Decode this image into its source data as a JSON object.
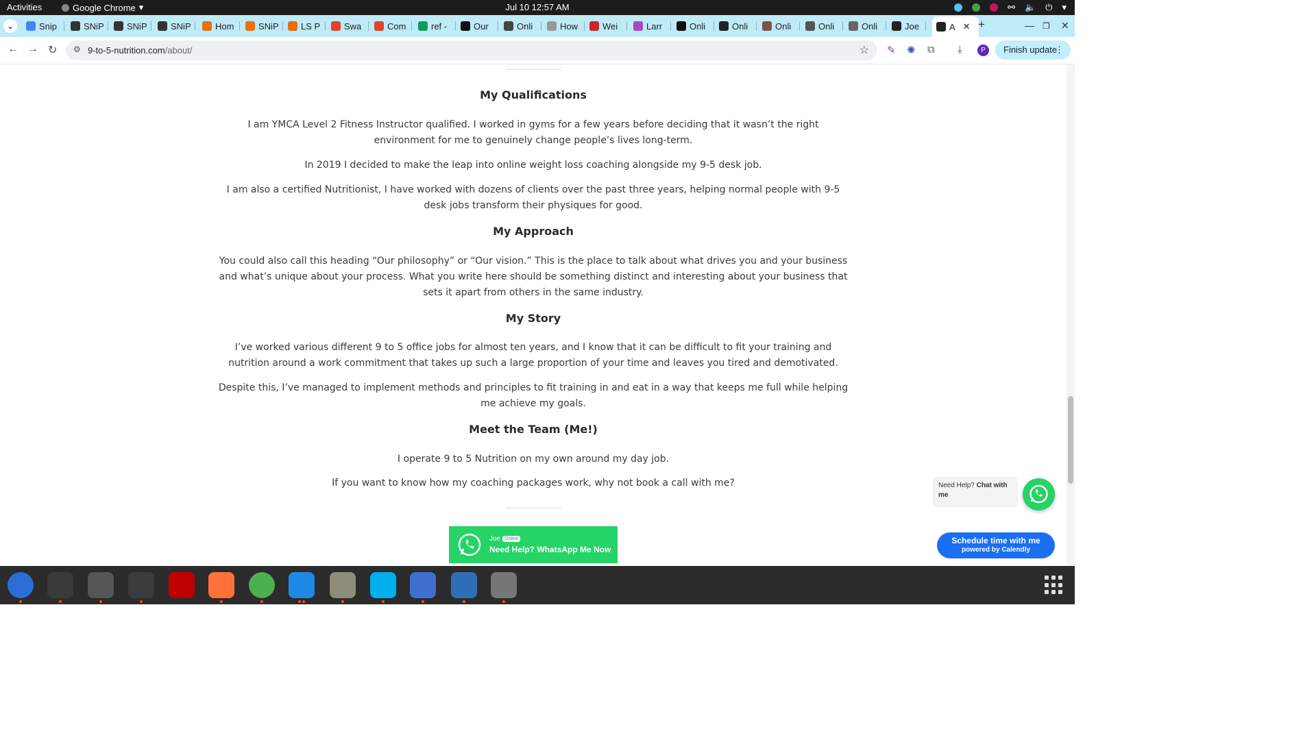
{
  "topbar": {
    "activities": "Activities",
    "app_name": "Google Chrome",
    "clock": "Jul 10  12:57 AM"
  },
  "tabs": [
    {
      "label": "Snip",
      "icon": "doc-icon",
      "color": "#4285f4"
    },
    {
      "label": "SNiP",
      "icon": "snip-logo-icon",
      "color": "#333333"
    },
    {
      "label": "SNiP",
      "icon": "snip-logo-icon",
      "color": "#333333"
    },
    {
      "label": "SNiP",
      "icon": "snip-logo-icon",
      "color": "#333333"
    },
    {
      "label": "Hom",
      "icon": "ls-logo-icon",
      "color": "#e8710a"
    },
    {
      "label": "SNiP",
      "icon": "ls-logo-icon",
      "color": "#e8710a"
    },
    {
      "label": "LS P",
      "icon": "ls-logo-icon",
      "color": "#e8710a"
    },
    {
      "label": "Swa",
      "icon": "gitlab-icon",
      "color": "#e24329"
    },
    {
      "label": "Com",
      "icon": "gitlab-icon",
      "color": "#e24329"
    },
    {
      "label": "ref -",
      "icon": "sheets-icon",
      "color": "#0f9d58"
    },
    {
      "label": "Our",
      "icon": "github-icon",
      "color": "#111111"
    },
    {
      "label": "Onli",
      "icon": "arrow-icon",
      "color": "#444444"
    },
    {
      "label": "How",
      "icon": "globe-icon",
      "color": "#999999"
    },
    {
      "label": "Wei",
      "icon": "chart-icon",
      "color": "#c62828"
    },
    {
      "label": "Larr",
      "icon": "c-logo-icon",
      "color": "#ab47bc"
    },
    {
      "label": "Onli",
      "icon": "square-icon",
      "color": "#111111"
    },
    {
      "label": "Onli",
      "icon": "square-icon",
      "color": "#222222"
    },
    {
      "label": "Onli",
      "icon": "photo-icon",
      "color": "#795548"
    },
    {
      "label": "Onli",
      "icon": "glasses-icon",
      "color": "#555555"
    },
    {
      "label": "Onli",
      "icon": "globe-icon",
      "color": "#666666"
    },
    {
      "label": "Joe",
      "icon": "headset-icon",
      "color": "#222222"
    },
    {
      "label": "A",
      "icon": "headset-icon",
      "color": "#222222"
    }
  ],
  "toolbar": {
    "url_host": "9-to-5-nutrition.com",
    "url_path": "/about/",
    "profile_initial": "P",
    "finish_update": "Finish update"
  },
  "content": {
    "qualifications": {
      "heading": "My Qualifications",
      "p1": "I am YMCA Level 2 Fitness Instructor qualified. I worked in gyms for a few years before deciding that it wasn’t the right environment for me to genuinely change people’s lives long-term.",
      "p2": "In 2019 I decided to make the leap into online weight loss coaching alongside my 9-5 desk job.",
      "p3": "I am also a certified Nutritionist, I have worked with dozens of clients over the past three years, helping normal people with 9-5 desk jobs transform their physiques for good."
    },
    "approach": {
      "heading": "My Approach",
      "p1": "You could also call this heading “Our philosophy” or “Our vision.” This is the place to talk about what drives you and your business and what’s unique about your process. What you write here should be something distinct and interesting about your business that sets it apart from others in the same industry."
    },
    "story": {
      "heading": "My Story",
      "p1": "I’ve worked various different 9 to 5 office jobs for almost ten years, and I know that it can be difficult to fit your training and nutrition around a work commitment that takes up such a large proportion of your time and leaves you tired and demotivated.",
      "p2": "Despite this, I’ve managed to implement methods and principles to fit training in and eat in a way that keeps me full while helping me achieve my goals."
    },
    "team": {
      "heading": "Meet the Team (Me!)",
      "p1": "I operate 9 to 5 Nutrition on my own around my day job.",
      "p2": "If you want to know how my coaching packages work, why not book a call with me?"
    }
  },
  "widgets": {
    "help_prefix": "Need Help?",
    "help_bold": "Chat with me",
    "calendly_l1": "Schedule time with me",
    "calendly_l2": "powered by Calendly",
    "wa_name": "Joe",
    "wa_status": "Online",
    "wa_text": "Need Help? WhatsApp Me Now"
  },
  "dock": [
    {
      "name": "thunderbird",
      "color": "#2a6fd6"
    },
    {
      "name": "terminal",
      "color": "#3a3a3a"
    },
    {
      "name": "calculator",
      "color": "#555555"
    },
    {
      "name": "system-monitor",
      "color": "#3b3b3b"
    },
    {
      "name": "filezilla",
      "color": "#bf0000"
    },
    {
      "name": "firefox",
      "color": "#ff7139"
    },
    {
      "name": "chrome",
      "color": "#4caf50"
    },
    {
      "name": "vscode",
      "color": "#1e88e5"
    },
    {
      "name": "files",
      "color": "#8d8d7a"
    },
    {
      "name": "skype",
      "color": "#00aff0"
    },
    {
      "name": "text-editor",
      "color": "#3f6fd1"
    },
    {
      "name": "document-viewer",
      "color": "#2f6eb5"
    },
    {
      "name": "disk-utility",
      "color": "#777777"
    }
  ]
}
